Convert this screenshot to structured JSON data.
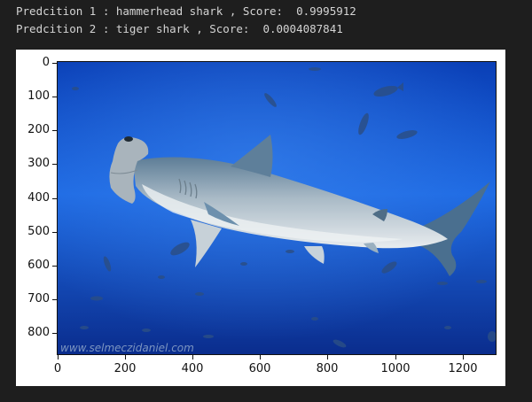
{
  "output": {
    "line1": "Predcition 1 : hammerhead shark , Score:  0.9995912",
    "line2": "Predcition 2 : tiger shark , Score:  0.0004087841"
  },
  "image": {
    "watermark": "www.selmeczidaniel.com",
    "subject": "hammerhead-shark",
    "colors": {
      "water_top": "#0b3fb8",
      "water_mid": "#1f6ce6",
      "water_bottom": "#0a2a8a",
      "shark_body": "#8fa4b4",
      "shark_belly": "#e6e6e6"
    }
  },
  "axes": {
    "y_ticks": [
      "0",
      "100",
      "200",
      "300",
      "400",
      "500",
      "600",
      "700",
      "800"
    ],
    "x_ticks": [
      "0",
      "200",
      "400",
      "600",
      "800",
      "1000",
      "1200"
    ],
    "x_range": [
      0,
      1300
    ],
    "y_range": [
      0,
      870
    ]
  }
}
